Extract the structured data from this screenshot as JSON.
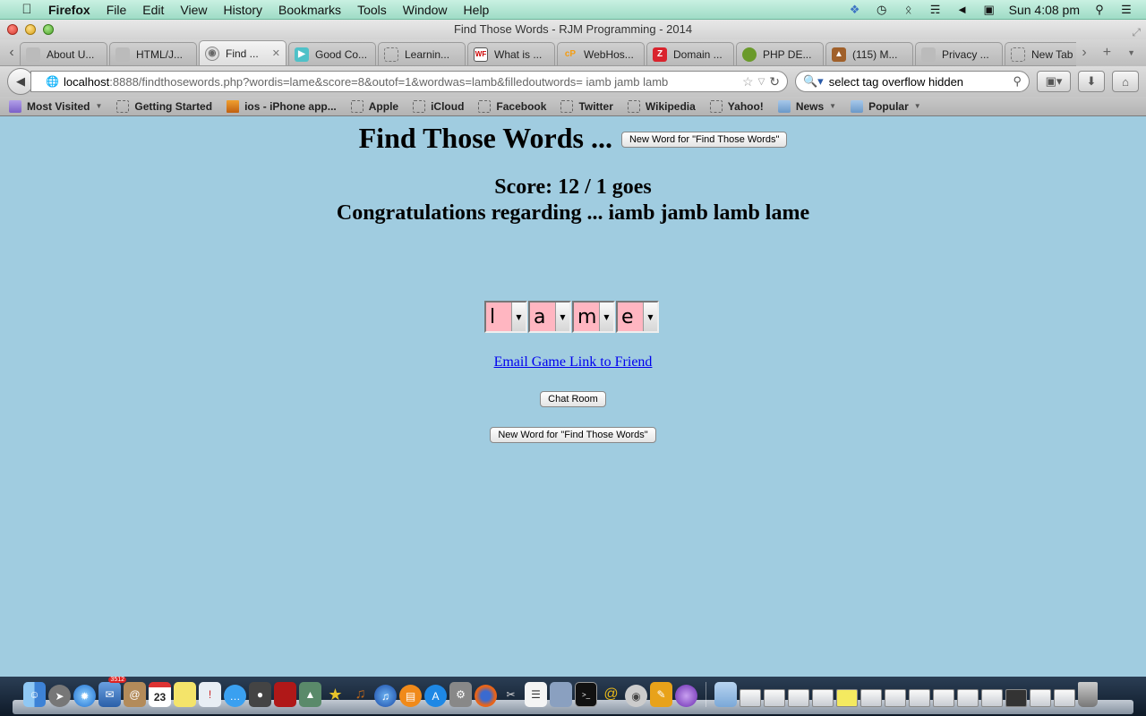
{
  "menubar": {
    "apple_icon": "apple-logo",
    "items": [
      "Firefox",
      "File",
      "Edit",
      "View",
      "History",
      "Bookmarks",
      "Tools",
      "Window",
      "Help"
    ],
    "tray_icons": [
      "dropbox-icon",
      "time-machine-icon",
      "bluetooth-icon",
      "wifi-icon",
      "volume-icon",
      "activity-monitor-icon"
    ],
    "clock": "Sun 4:08 pm",
    "spotlight_icon": "search-icon",
    "notifications_icon": "list-icon"
  },
  "window": {
    "title": "Find Those Words - RJM Programming - 2014"
  },
  "tabs": [
    {
      "label": "About U...",
      "icon": "generic",
      "active": false
    },
    {
      "label": "HTML/J...",
      "icon": "generic",
      "active": false
    },
    {
      "label": "Find ...",
      "icon": "globe",
      "active": true
    },
    {
      "label": "Good Co...",
      "icon": "screen",
      "active": false
    },
    {
      "label": "Learnin...",
      "icon": "blank",
      "active": false
    },
    {
      "label": "What is ...",
      "icon": "wf",
      "active": false
    },
    {
      "label": "WebHos...",
      "icon": "cpanel",
      "active": false
    },
    {
      "label": "Domain ...",
      "icon": "z",
      "active": false
    },
    {
      "label": "PHP DE...",
      "icon": "php",
      "active": false
    },
    {
      "label": "(115) M...",
      "icon": "lock",
      "active": false
    },
    {
      "label": "Privacy ...",
      "icon": "generic",
      "active": false
    },
    {
      "label": "New Tab",
      "icon": "blank",
      "active": false
    }
  ],
  "navbar": {
    "url_host": "localhost",
    "url_path": ":8888/findthosewords.php?wordis=lame&score=8&outof=1&wordwas=lamb&filledoutwords= iamb jamb lamb",
    "search_value": "select tag overflow hidden"
  },
  "bookmarks": [
    {
      "label": "Most Visited",
      "type": "mv",
      "dropdown": true
    },
    {
      "label": "Getting Started",
      "type": "blank",
      "dropdown": false
    },
    {
      "label": "ios - iPhone app...",
      "type": "so",
      "dropdown": false
    },
    {
      "label": "Apple",
      "type": "blank",
      "dropdown": false
    },
    {
      "label": "iCloud",
      "type": "blank",
      "dropdown": false
    },
    {
      "label": "Facebook",
      "type": "blank",
      "dropdown": false
    },
    {
      "label": "Twitter",
      "type": "blank",
      "dropdown": false
    },
    {
      "label": "Wikipedia",
      "type": "blank",
      "dropdown": false
    },
    {
      "label": "Yahoo!",
      "type": "blank",
      "dropdown": false
    },
    {
      "label": "News",
      "type": "folder",
      "dropdown": true
    },
    {
      "label": "Popular",
      "type": "folder",
      "dropdown": true
    }
  ],
  "page": {
    "heading": "Find Those Words ...",
    "new_word_button": "New Word for \"Find Those Words\"",
    "score": "Score: 12 / 1 goes",
    "congrats": "Congratulations regarding ... iamb jamb lamb lame",
    "letters": [
      "l",
      "a",
      "m",
      "e"
    ],
    "email_link": "Email Game Link to Friend",
    "chat_button": "Chat Room",
    "new_word_button_2": "New Word for \"Find Those Words\""
  },
  "colors": {
    "page_background": "#a0cce0",
    "letter_background": "#ffb6c1",
    "link": "#0000ee"
  },
  "dock": {
    "apps": [
      "finder",
      "launchpad",
      "safari",
      "mail",
      "contacts",
      "calendar",
      "notes",
      "reminders",
      "messages",
      "facetime",
      "photo-booth",
      "iphoto",
      "imovie",
      "garageband",
      "itunes",
      "ibooks",
      "app-store",
      "system-preferences",
      "firefox",
      "preview",
      "textedit",
      "image-capture",
      "terminal",
      "dreamweaver",
      "filezilla",
      "scripteditor",
      "quicktime"
    ],
    "calendar_day": "23",
    "mail_badge": "3512"
  }
}
